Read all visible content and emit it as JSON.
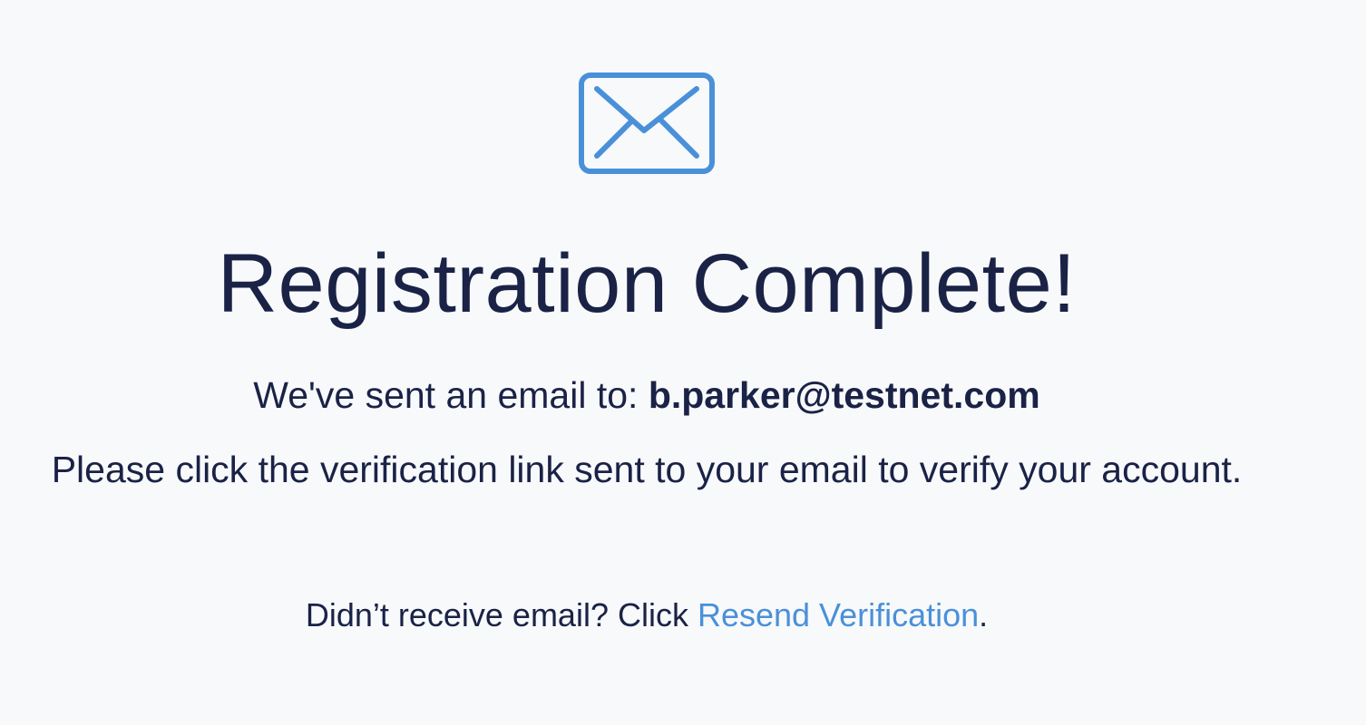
{
  "icon": {
    "name": "envelope-icon",
    "color": "#4a90d9"
  },
  "title": "Registration Complete!",
  "sent": {
    "prefix": "We've sent an email to: ",
    "email": "b.parker@testnet.com"
  },
  "instruction": "Please click the verification link sent to your email to verify your account.",
  "resend": {
    "prefix": "Didn’t receive email? Click ",
    "link_label": "Resend Verification",
    "suffix": "."
  },
  "colors": {
    "text": "#1a2246",
    "accent": "#4a90d9",
    "background": "#f8f9fb"
  }
}
